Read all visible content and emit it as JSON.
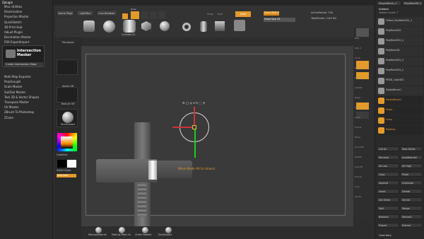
{
  "menu": [
    "Alpha",
    "Brush",
    "Color",
    "Document",
    "Draw",
    "Edit",
    "File",
    "Layer",
    "Light",
    "Macro",
    "Marker",
    "Material",
    "Movie",
    "Picker",
    "Preferences",
    "Render",
    "Stencil",
    "Stroke",
    "Texture",
    "Tool",
    "Transform",
    "Zplugin",
    "Zscript",
    "Help"
  ],
  "left_panel": {
    "header": "Zplugin",
    "top_items": [
      "Misc Utilities",
      "Deactivation",
      "Projection Master",
      "QuickSketch",
      "3D Print Hub",
      "Adjust Plugin",
      "Decimation Master",
      "FBX ExportImport",
      "Intersection Masker"
    ],
    "plugin_title": "Intersection Masker",
    "plugin_button": "Create Intersection Mask",
    "bottom_items": [
      "Multi Map Exporter",
      "PolyGroupIt",
      "Scale Master",
      "SubTool Master",
      "Text 3D & Vector Shapes",
      "Transpose Master",
      "UV Master",
      "ZBrush To Photoshop",
      "ZColor"
    ]
  },
  "tool_shelf": {
    "brush_label": "Transpose",
    "alpha_label": "Alpha Off",
    "texture_label": "Texture Off",
    "material_label": "SkinShade4",
    "gradient_label": "Gradient",
    "switch_label": "SwitchColor",
    "alternate_label": "Alternate"
  },
  "top_toolbar": {
    "home_page": "Home Page",
    "lightbox": "LightBox",
    "live_boolean": "Live Boolean",
    "mesh_label": "Cylinder12",
    "edit": "Edit",
    "draw": "Draw",
    "move": "Move",
    "scale": "Scale",
    "rotate": "Rotate",
    "mrgb": "Mrgb",
    "rgb": "Rgb",
    "m": "M",
    "zadd": "Zadd",
    "zsub": "Zsub",
    "zcut": "Zcut",
    "focal_shift": "Focal Shift 0",
    "draw_size": "Draw Size 29",
    "dynamic": "Dynamic",
    "active_points": "ActivePoints: 704",
    "total_points": "TotalPoints: 2.83 Mil",
    "rgb_intensity": "Rgb Intensity",
    "z_intensity": "Z Intensity"
  },
  "viewport": {
    "tooltip": "Move Mode Alt to Unlock"
  },
  "material_bar": [
    "StartupMaterial",
    "MatCap Pearl Ca",
    "Green Metallic",
    "SkinShade4"
  ],
  "right_tools": [
    "BPR",
    "SPix 3",
    "Scroll",
    "Zoom",
    "Actual",
    "AAHalf",
    "Persp",
    "Floor",
    "Local",
    "Frame",
    "Move",
    "Zoom3D",
    "Rotate",
    "Line Fill",
    "Transp",
    "Solo",
    "Xpose"
  ],
  "right_panel": {
    "header_tool": "SimpleBrush_1",
    "header_tool2": "PolyMesh3D_1",
    "subtool_title": "Subtool",
    "visible_count": "Visible Count 7",
    "subtools": [
      "CMesh_PolyMesh3D1_1",
      "PolyMesh3D1",
      "PolyMesh3D1_4",
      "PolyMesh3D",
      "PolyMesh3D1_3",
      "PolyMesh3D1_2",
      "PM3D_Cube3D1",
      "SimpleBrush1"
    ],
    "folders": [
      "SimpleBrush1",
      "Hinge",
      "Lamp",
      "Rotating"
    ],
    "buttons": [
      "List All",
      "New Folder",
      "Rename",
      "AutoReorder",
      "All Low",
      "All High",
      "Copy",
      "Paste",
      "Append",
      "Duplicate",
      "Insert",
      "Delete",
      "Del Other",
      "Del All",
      "Split",
      "Merge",
      "Boolean",
      "Remesh",
      "Project",
      "Extract"
    ],
    "geometry": "Geometry"
  },
  "colors": {
    "accent": "#e39a2b",
    "background": "#2d2d2d",
    "canvas": "#3e3e3e"
  }
}
